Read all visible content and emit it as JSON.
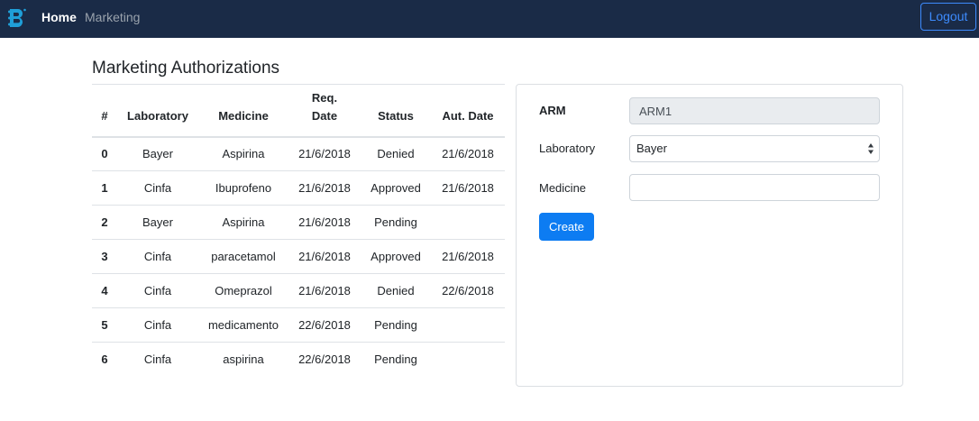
{
  "navbar": {
    "home_label": "Home",
    "marketing_label": "Marketing",
    "logout_label": "Logout",
    "brand_icon": "b-logo-icon"
  },
  "page": {
    "title": "Marketing Authorizations"
  },
  "table": {
    "headers": {
      "index": "#",
      "laboratory": "Laboratory",
      "medicine": "Medicine",
      "req_date_line1": "Req.",
      "req_date_line2": "Date",
      "status": "Status",
      "aut_date": "Aut. Date"
    },
    "rows": [
      {
        "index": "0",
        "laboratory": "Bayer",
        "medicine": "Aspirina",
        "req_date": "21/6/2018",
        "status": "Denied",
        "aut_date": "21/6/2018"
      },
      {
        "index": "1",
        "laboratory": "Cinfa",
        "medicine": "Ibuprofeno",
        "req_date": "21/6/2018",
        "status": "Approved",
        "aut_date": "21/6/2018"
      },
      {
        "index": "2",
        "laboratory": "Bayer",
        "medicine": "Aspirina",
        "req_date": "21/6/2018",
        "status": "Pending",
        "aut_date": ""
      },
      {
        "index": "3",
        "laboratory": "Cinfa",
        "medicine": "paracetamol",
        "req_date": "21/6/2018",
        "status": "Approved",
        "aut_date": "21/6/2018"
      },
      {
        "index": "4",
        "laboratory": "Cinfa",
        "medicine": "Omeprazol",
        "req_date": "21/6/2018",
        "status": "Denied",
        "aut_date": "22/6/2018"
      },
      {
        "index": "5",
        "laboratory": "Cinfa",
        "medicine": "medicamento",
        "req_date": "22/6/2018",
        "status": "Pending",
        "aut_date": ""
      },
      {
        "index": "6",
        "laboratory": "Cinfa",
        "medicine": "aspirina",
        "req_date": "22/6/2018",
        "status": "Pending",
        "aut_date": ""
      }
    ]
  },
  "form": {
    "arm_label": "ARM",
    "arm_value": "ARM1",
    "laboratory_label": "Laboratory",
    "laboratory_selected": "Bayer",
    "medicine_label": "Medicine",
    "medicine_value": "",
    "create_label": "Create"
  },
  "colors": {
    "navbar_bg": "#1a2b47",
    "primary": "#0d7cf2",
    "outline_primary": "#3d8bfd"
  }
}
